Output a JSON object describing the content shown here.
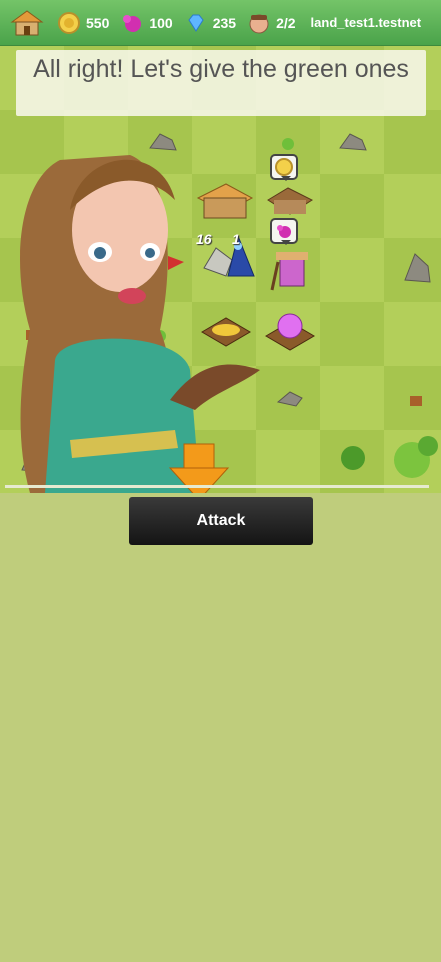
{
  "topbar": {
    "home_icon": "village-house-icon",
    "resources": [
      {
        "icon": "gold-coin-icon",
        "value": "550"
      },
      {
        "icon": "magic-orb-icon",
        "value": "100"
      },
      {
        "icon": "diamond-icon",
        "value": "235"
      },
      {
        "icon": "worker-face-icon",
        "value": "2/2"
      }
    ],
    "account": "land_test1.testnet"
  },
  "hint": {
    "text": "All right! Let's give the green ones"
  },
  "units": {
    "warrior_count": "16",
    "wizard_count": "1"
  },
  "actions": {
    "attack_label": "Attack"
  },
  "colors": {
    "topbar": "#5cb85c",
    "board_light": "#b5cf5c",
    "board_dark": "#a3c24c",
    "background": "#bfcd7c",
    "button": "#222222"
  }
}
